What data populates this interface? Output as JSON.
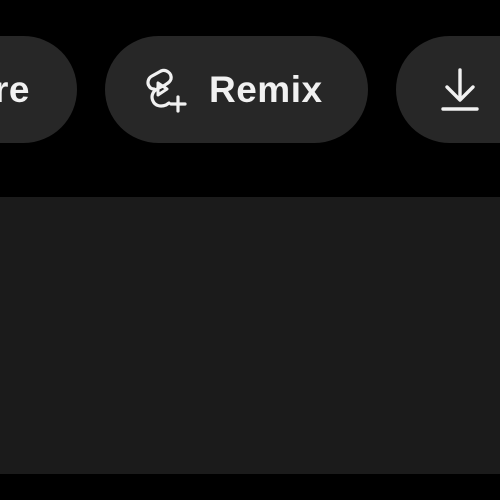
{
  "action_bar": {
    "share": {
      "label": "re"
    },
    "remix": {
      "label": "Remix",
      "icon": "shorts-remix-icon"
    },
    "download": {
      "icon": "download-icon"
    }
  },
  "colors": {
    "background": "#000000",
    "pill_background": "#272727",
    "text": "#f1f1f1",
    "panel_background": "#1b1b1b"
  }
}
